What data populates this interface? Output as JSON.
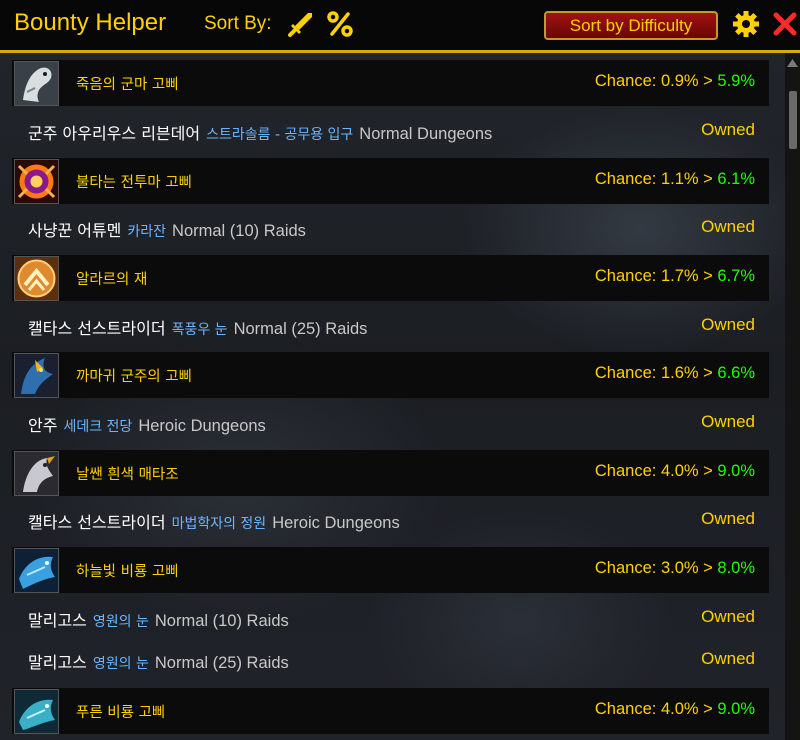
{
  "header": {
    "title": "Bounty Helper",
    "sort_label": "Sort By:",
    "sort_button": "Sort by Difficulty",
    "icons": [
      "sword-icon",
      "percent-icon",
      "gear-icon",
      "close-icon"
    ]
  },
  "colors": {
    "accent_gold": "#ffd100",
    "up_green": "#1eff00",
    "zone_blue": "#6cb6ff",
    "button_red": "#a11212"
  },
  "rows": [
    {
      "type": "drop",
      "name": "죽음의 군마 고삐",
      "chance_label": "Chance:",
      "chance_from": "0.9%",
      "arrow": ">",
      "chance_to": "5.9%",
      "icon": "skeletal-horse-icon"
    },
    {
      "type": "boss",
      "name": "군주 아우리우스 리븐데어",
      "zone": "스트라솔름 - 공무용 입구",
      "difficulty": "Normal Dungeons",
      "status": "Owned"
    },
    {
      "type": "drop",
      "name": "불타는 전투마 고삐",
      "chance_label": "Chance:",
      "chance_from": "1.1%",
      "arrow": ">",
      "chance_to": "6.1%",
      "icon": "fiery-warhorse-icon"
    },
    {
      "type": "boss",
      "name": "사냥꾼 어튜멘",
      "zone": "카라잔",
      "difficulty": "Normal (10) Raids",
      "status": "Owned"
    },
    {
      "type": "drop",
      "name": "알라르의 재",
      "chance_label": "Chance:",
      "chance_from": "1.7%",
      "arrow": ">",
      "chance_to": "6.7%",
      "icon": "phoenix-ash-icon"
    },
    {
      "type": "boss",
      "name": "캘타스 선스트라이더",
      "zone": "폭풍우 눈",
      "difficulty": "Normal (25) Raids",
      "status": "Owned"
    },
    {
      "type": "drop",
      "name": "까마귀 군주의 고삐",
      "chance_label": "Chance:",
      "chance_from": "1.6%",
      "arrow": ">",
      "chance_to": "6.6%",
      "icon": "raven-lord-icon"
    },
    {
      "type": "boss",
      "name": "안주",
      "zone": "세데크 전당",
      "difficulty": "Heroic Dungeons",
      "status": "Owned"
    },
    {
      "type": "drop",
      "name": "날쌘 흰색 매타조",
      "chance_label": "Chance:",
      "chance_from": "4.0%",
      "arrow": ">",
      "chance_to": "9.0%",
      "icon": "white-hawkstrider-icon"
    },
    {
      "type": "boss",
      "name": "캘타스 선스트라이더",
      "zone": "마법학자의 정원",
      "difficulty": "Heroic Dungeons",
      "status": "Owned"
    },
    {
      "type": "drop",
      "name": "하늘빛 비룡 고삐",
      "chance_label": "Chance:",
      "chance_from": "3.0%",
      "arrow": ">",
      "chance_to": "8.0%",
      "icon": "azure-drake-icon"
    },
    {
      "type": "boss",
      "name": "말리고스",
      "zone": "영원의 눈",
      "difficulty": "Normal (10) Raids",
      "status": "Owned"
    },
    {
      "type": "boss",
      "name": "말리고스",
      "zone": "영원의 눈",
      "difficulty": "Normal (25) Raids",
      "status": "Owned"
    },
    {
      "type": "drop",
      "name": "푸른 비룡 고삐",
      "chance_label": "Chance:",
      "chance_from": "4.0%",
      "arrow": ">",
      "chance_to": "9.0%",
      "icon": "blue-drake-icon"
    }
  ]
}
